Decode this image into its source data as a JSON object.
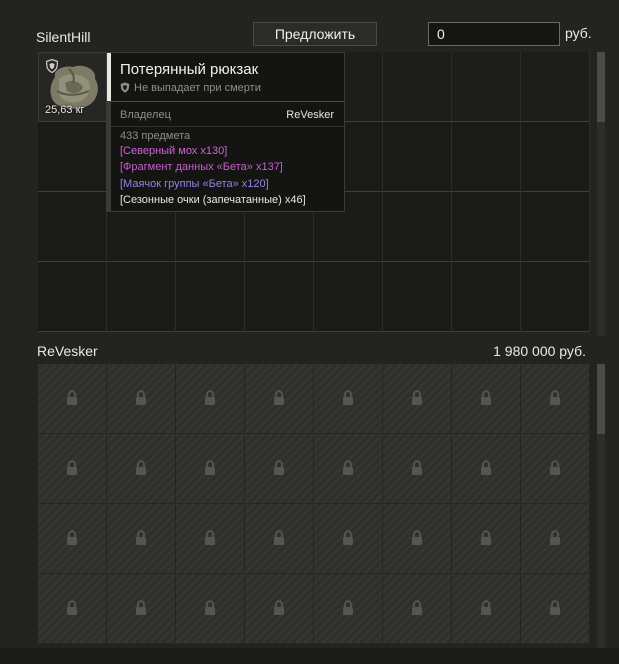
{
  "header": {
    "trader_name": "SilentHill",
    "offer_button": "Предложить",
    "price_value": "0",
    "currency": "руб."
  },
  "item": {
    "weight": "25,63 кг",
    "icon": "backpack-image"
  },
  "tooltip": {
    "title": "Потерянный рюкзак",
    "note": "Не выпадает при смерти",
    "owner_label": "Владелец",
    "owner_value": "ReVesker",
    "count": "433 предмета",
    "contents": [
      {
        "text": "[Северный мох x130]",
        "color": "#d064d8"
      },
      {
        "text": "[Фрагмент данных «Бета» x137]",
        "color": "#c45fcc"
      },
      {
        "text": "[Маячок группы «Бета» x120]",
        "color": "#8d86e6"
      },
      {
        "text": "[Сезонные очки (запечатанные) x46]",
        "color": "#e6e6e0"
      }
    ]
  },
  "player": {
    "name": "ReVesker",
    "money": "1 980 000 руб."
  },
  "icons": {
    "shield": "shield-icon",
    "lock": "lock-icon"
  }
}
